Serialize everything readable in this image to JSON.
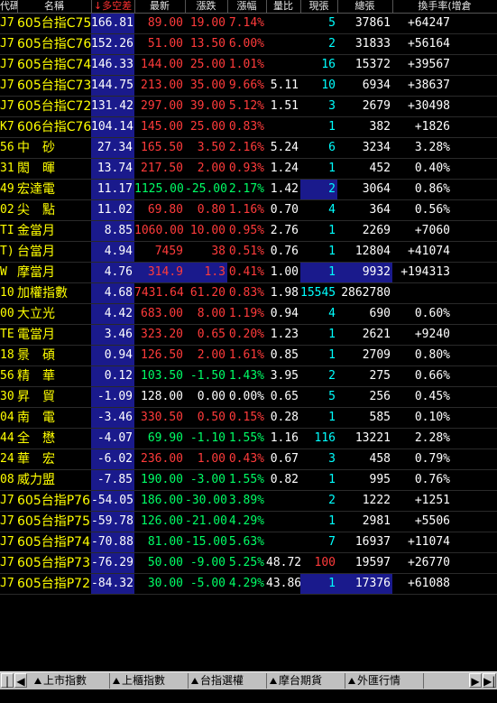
{
  "headers": [
    "代碼",
    "名稱",
    "↓多空差",
    "最新",
    "漲跌",
    "漲幅",
    "量比",
    "現張",
    "總張",
    "換手率(增倉"
  ],
  "rows": [
    {
      "code": "J7",
      "name": "605台指C75",
      "diff": "166.81",
      "last": "89.00",
      "chg": "19.00",
      "pct": "7.14%",
      "vr": "",
      "cur": "5",
      "total": "37861",
      "turn": "+64247",
      "last_c": "red",
      "chg_c": "red",
      "pct_c": "red"
    },
    {
      "code": "J7",
      "name": "605台指C76",
      "diff": "152.26",
      "last": "51.00",
      "chg": "13.50",
      "pct": "6.00%",
      "vr": "",
      "cur": "2",
      "total": "31833",
      "turn": "+56164",
      "last_c": "red",
      "chg_c": "red",
      "pct_c": "red"
    },
    {
      "code": "J7",
      "name": "605台指C74",
      "diff": "146.33",
      "last": "144.00",
      "chg": "25.00",
      "pct": "1.01%",
      "vr": "",
      "cur": "16",
      "total": "15372",
      "turn": "+39567",
      "last_c": "red",
      "chg_c": "red",
      "pct_c": "red"
    },
    {
      "code": "J7",
      "name": "605台指C73",
      "diff": "144.75",
      "last": "213.00",
      "chg": "35.00",
      "pct": "9.66%",
      "vr": "5.11",
      "cur": "10",
      "total": "6934",
      "turn": "+38637",
      "last_c": "red",
      "chg_c": "red",
      "pct_c": "red"
    },
    {
      "code": "J7",
      "name": "605台指C72",
      "diff": "131.42",
      "last": "297.00",
      "chg": "39.00",
      "pct": "5.12%",
      "vr": "1.51",
      "cur": "3",
      "total": "2679",
      "turn": "+30498",
      "last_c": "red",
      "chg_c": "red",
      "pct_c": "red"
    },
    {
      "code": "K7",
      "name": "606台指C76",
      "diff": "104.14",
      "last": "145.00",
      "chg": "25.00",
      "pct": "0.83%",
      "vr": "",
      "cur": "1",
      "total": "382",
      "turn": "+1826",
      "last_c": "red",
      "chg_c": "red",
      "pct_c": "red"
    },
    {
      "code": "56",
      "name": "中　砂",
      "diff": "27.34",
      "last": "165.50",
      "chg": "3.50",
      "pct": "2.16%",
      "vr": "5.24",
      "cur": "6",
      "total": "3234",
      "turn": "3.28%",
      "last_c": "red",
      "chg_c": "red",
      "pct_c": "red"
    },
    {
      "code": "31",
      "name": "閎　暉",
      "diff": "13.74",
      "last": "217.50",
      "chg": "2.00",
      "pct": "0.93%",
      "vr": "1.24",
      "cur": "1",
      "total": "452",
      "turn": "0.40%",
      "last_c": "red",
      "chg_c": "red",
      "pct_c": "red"
    },
    {
      "code": "49",
      "name": "宏達電",
      "diff": "11.17",
      "last": "1125.00",
      "chg": "-25.00",
      "pct": "2.17%",
      "vr": "1.42",
      "cur": "2",
      "total": "3064",
      "turn": "0.86%",
      "last_c": "green",
      "chg_c": "green",
      "pct_c": "green",
      "curhl": true
    },
    {
      "code": "02",
      "name": "尖　點",
      "diff": "11.02",
      "last": "69.80",
      "chg": "0.80",
      "pct": "1.16%",
      "vr": "0.70",
      "cur": "4",
      "total": "364",
      "turn": "0.56%",
      "last_c": "red",
      "chg_c": "red",
      "pct_c": "red"
    },
    {
      "code": "TI",
      "name": "金當月",
      "diff": "8.85",
      "last": "1060.00",
      "chg": "10.00",
      "pct": "0.95%",
      "vr": "2.76",
      "cur": "1",
      "total": "2269",
      "turn": "+7060",
      "last_c": "red",
      "chg_c": "red",
      "pct_c": "red"
    },
    {
      "code": "T)",
      "name": "台當月",
      "diff": "4.94",
      "last": "7459",
      "chg": "38",
      "pct": "0.51%",
      "vr": "0.76",
      "cur": "1",
      "total": "12804",
      "turn": "+41074",
      "last_c": "red",
      "chg_c": "red",
      "pct_c": "red"
    },
    {
      "code": "W",
      "name": "摩當月",
      "diff": "4.76",
      "last": "314.9",
      "chg": "1.3",
      "pct": "0.41%",
      "vr": "1.00",
      "cur": "1",
      "total": "9932",
      "turn": "+194313",
      "last_c": "red",
      "chg_c": "red",
      "pct_c": "red",
      "curhl": true,
      "totalhl": true
    },
    {
      "code": "10",
      "name": "加權指數",
      "diff": "4.68",
      "last": "7431.64",
      "chg": "61.20",
      "pct": "0.83%",
      "vr": "1.98",
      "cur": "15545",
      "total": "2862780",
      "turn": "",
      "last_c": "red",
      "chg_c": "red",
      "pct_c": "red"
    },
    {
      "code": "00",
      "name": "大立光",
      "diff": "4.42",
      "last": "683.00",
      "chg": "8.00",
      "pct": "1.19%",
      "vr": "0.94",
      "cur": "4",
      "total": "690",
      "turn": "0.60%",
      "last_c": "red",
      "chg_c": "red",
      "pct_c": "red"
    },
    {
      "code": "TE",
      "name": "電當月",
      "diff": "3.46",
      "last": "323.20",
      "chg": "0.65",
      "pct": "0.20%",
      "vr": "1.23",
      "cur": "1",
      "total": "2621",
      "turn": "+9240",
      "last_c": "red",
      "chg_c": "red",
      "pct_c": "red"
    },
    {
      "code": "18",
      "name": "景　碩",
      "diff": "0.94",
      "last": "126.50",
      "chg": "2.00",
      "pct": "1.61%",
      "vr": "0.85",
      "cur": "1",
      "total": "2709",
      "turn": "0.80%",
      "last_c": "red",
      "chg_c": "red",
      "pct_c": "red"
    },
    {
      "code": "56",
      "name": "精　華",
      "diff": "0.12",
      "last": "103.50",
      "chg": "-1.50",
      "pct": "1.43%",
      "vr": "3.95",
      "cur": "2",
      "total": "275",
      "turn": "0.66%",
      "last_c": "green",
      "chg_c": "green",
      "pct_c": "green"
    },
    {
      "code": "30",
      "name": "昇　貿",
      "diff": "-1.09",
      "last": "128.00",
      "chg": "0.00",
      "pct": "0.00%",
      "vr": "0.65",
      "cur": "5",
      "total": "256",
      "turn": "0.45%",
      "last_c": "white",
      "chg_c": "white",
      "pct_c": "white"
    },
    {
      "code": "04",
      "name": "南　電",
      "diff": "-3.46",
      "last": "330.50",
      "chg": "0.50",
      "pct": "0.15%",
      "vr": "0.28",
      "cur": "1",
      "total": "585",
      "turn": "0.10%",
      "last_c": "red",
      "chg_c": "red",
      "pct_c": "red"
    },
    {
      "code": "44",
      "name": "全　懋",
      "diff": "-4.07",
      "last": "69.90",
      "chg": "-1.10",
      "pct": "1.55%",
      "vr": "1.16",
      "cur": "116",
      "total": "13221",
      "turn": "2.28%",
      "last_c": "green",
      "chg_c": "green",
      "pct_c": "green"
    },
    {
      "code": "24",
      "name": "華　宏",
      "diff": "-6.02",
      "last": "236.00",
      "chg": "1.00",
      "pct": "0.43%",
      "vr": "0.67",
      "cur": "3",
      "total": "458",
      "turn": "0.79%",
      "last_c": "red",
      "chg_c": "red",
      "pct_c": "red"
    },
    {
      "code": "08",
      "name": "威力盟",
      "diff": "-7.85",
      "last": "190.00",
      "chg": "-3.00",
      "pct": "1.55%",
      "vr": "0.82",
      "cur": "1",
      "total": "995",
      "turn": "0.76%",
      "last_c": "green",
      "chg_c": "green",
      "pct_c": "green"
    },
    {
      "code": "J7",
      "name": "605台指P76",
      "diff": "-54.05",
      "last": "186.00",
      "chg": "-30.00",
      "pct": "3.89%",
      "vr": "",
      "cur": "2",
      "total": "1222",
      "turn": "+1251",
      "last_c": "green",
      "chg_c": "green",
      "pct_c": "green"
    },
    {
      "code": "J7",
      "name": "605台指P75",
      "diff": "-59.78",
      "last": "126.00",
      "chg": "-21.00",
      "pct": "4.29%",
      "vr": "",
      "cur": "1",
      "total": "2981",
      "turn": "+5506",
      "last_c": "green",
      "chg_c": "green",
      "pct_c": "green"
    },
    {
      "code": "J7",
      "name": "605台指P74",
      "diff": "-70.88",
      "last": "81.00",
      "chg": "-15.00",
      "pct": "5.63%",
      "vr": "",
      "cur": "7",
      "total": "16937",
      "turn": "+11074",
      "last_c": "green",
      "chg_c": "green",
      "pct_c": "green"
    },
    {
      "code": "J7",
      "name": "605台指P73",
      "diff": "-76.29",
      "last": "50.00",
      "chg": "-9.00",
      "pct": "5.25%",
      "vr": "48.72",
      "cur": "100",
      "total": "19597",
      "turn": "+26770",
      "last_c": "green",
      "chg_c": "green",
      "pct_c": "green",
      "curred": true
    },
    {
      "code": "J7",
      "name": "605台指P72",
      "diff": "-84.32",
      "last": "30.00",
      "chg": "-5.00",
      "pct": "4.29%",
      "vr": "43.86",
      "cur": "1",
      "total": "17376",
      "turn": "+61088",
      "last_c": "green",
      "chg_c": "green",
      "pct_c": "green",
      "curhl": true,
      "totalhl": true
    }
  ],
  "tabs": [
    "上市指數",
    "上櫃指數",
    "台指選權",
    "摩台期貨",
    "外匯行情"
  ],
  "nav": {
    "first": "|◀",
    "prev": "◀",
    "next": "▶",
    "last": "▶|"
  },
  "colors": {
    "up": "#ff3b3b",
    "down": "#00ff66",
    "flat": "#ffffff",
    "name": "#ffff00",
    "highlight": "#1a1a8c"
  }
}
